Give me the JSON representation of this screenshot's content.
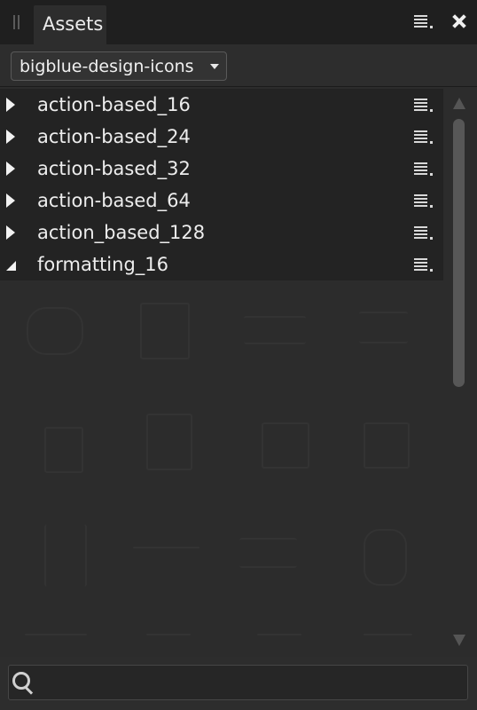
{
  "panel": {
    "tab_label": "Assets"
  },
  "category": {
    "selected": "bigblue-design-icons"
  },
  "list": {
    "rows": [
      {
        "label": "action-based_16",
        "expanded": false
      },
      {
        "label": "action-based_24",
        "expanded": false
      },
      {
        "label": "action-based_32",
        "expanded": false
      },
      {
        "label": "action-based_64",
        "expanded": false
      },
      {
        "label": "action_based_128",
        "expanded": false
      },
      {
        "label": "formatting_16",
        "expanded": true
      }
    ]
  },
  "search": {
    "value": "",
    "placeholder": ""
  },
  "icons": {
    "grip": "drag-grip-icon",
    "panel_menu": "hamburger-menu-icon",
    "close": "close-icon",
    "dropdown": "chevron-down-icon",
    "collapsed": "triangle-right-icon",
    "expanded": "triangle-down-icon",
    "row_menu": "hamburger-menu-icon",
    "scroll_up": "arrow-up-icon",
    "scroll_down": "arrow-down-icon",
    "search": "search-icon"
  },
  "colors": {
    "background": "#2a2a2a",
    "titlebar": "#1f1f1f",
    "row": "#232323",
    "text": "#ededed",
    "scroll_thumb": "#575757"
  }
}
